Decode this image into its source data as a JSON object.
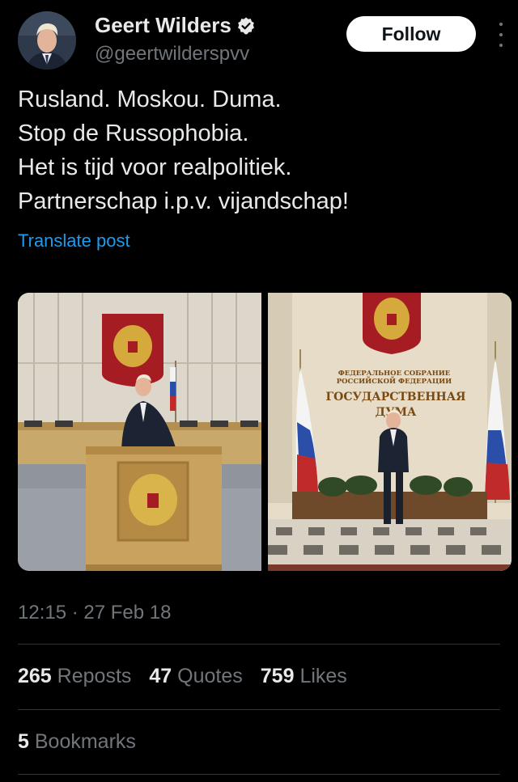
{
  "author": {
    "display_name": "Geert Wilders",
    "handle": "@geertwilderspvv",
    "verified_icon": "verified-badge-icon"
  },
  "follow_label": "Follow",
  "tweet": {
    "lines": [
      "Rusland. Moskou. Duma.",
      "Stop de Russophobia.",
      "Het is tijd voor realpolitiek.",
      "Partnerschap i.p.v. vijandschap!"
    ],
    "translate_label": "Translate post"
  },
  "media": {
    "right_sign": {
      "line1": "ФЕДЕРАЛЬНОЕ СОБРАНИЕ",
      "line2": "РОССИЙСКОЙ ФЕДЕРАЦИИ",
      "line3": "ГОСУДАРСТВЕННАЯ",
      "line4": "ДУМА"
    }
  },
  "timestamp": "12:15 · 27 Feb 18",
  "stats": {
    "reposts_count": "265",
    "reposts_label": "Reposts",
    "quotes_count": "47",
    "quotes_label": "Quotes",
    "likes_count": "759",
    "likes_label": "Likes",
    "bookmarks_count": "5",
    "bookmarks_label": "Bookmarks"
  },
  "colors": {
    "background": "#000000",
    "text": "#e7e9ea",
    "muted": "#71767b",
    "link": "#1d9bf0",
    "verified": "#e7e9ea"
  }
}
